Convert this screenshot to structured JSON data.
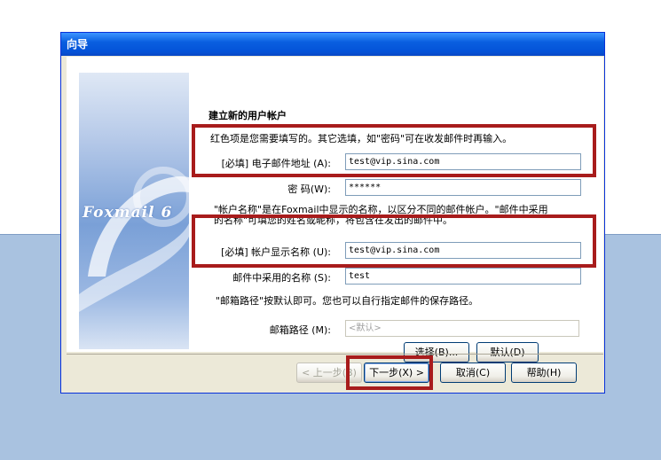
{
  "window": {
    "title": "向导"
  },
  "banner": {
    "brand_text": "Foxmail 6"
  },
  "heading": "建立新的用户帐户",
  "intro": "红色项是您需要填写的。其它选填，如\"密码\"可在收发邮件时再输入。",
  "email": {
    "label": "[必填] 电子邮件地址 (A):",
    "value": "test@vip.sina.com"
  },
  "password": {
    "label": "密 码(W):",
    "value": "******"
  },
  "account_note": {
    "line1": "\"帐户名称\"是在Foxmail中显示的名称，以区分不同的邮件帐户。\"邮件中采用",
    "line2": "的名称\"可填您的姓名或昵称，将包含在发出的邮件中。"
  },
  "display_name": {
    "label": "[必填] 帐户显示名称 (U):",
    "value": "test@vip.sina.com"
  },
  "sender_name": {
    "label": "邮件中采用的名称 (S):",
    "value": "test"
  },
  "path_note": "\"邮箱路径\"按默认即可。您也可以自行指定邮件的保存路径。",
  "mailbox_path": {
    "label": "邮箱路径 (M):",
    "placeholder": "<默认>"
  },
  "buttons": {
    "choose": "选择(B)...",
    "default": "默认(D)",
    "back": "< 上一步(B)",
    "next": "下一步(X) >",
    "cancel": "取消(C)",
    "help": "帮助(H)"
  },
  "colors": {
    "highlight": "#a81c1c",
    "titlebar": "#0a5fe0",
    "background": "#a9c2e0"
  }
}
